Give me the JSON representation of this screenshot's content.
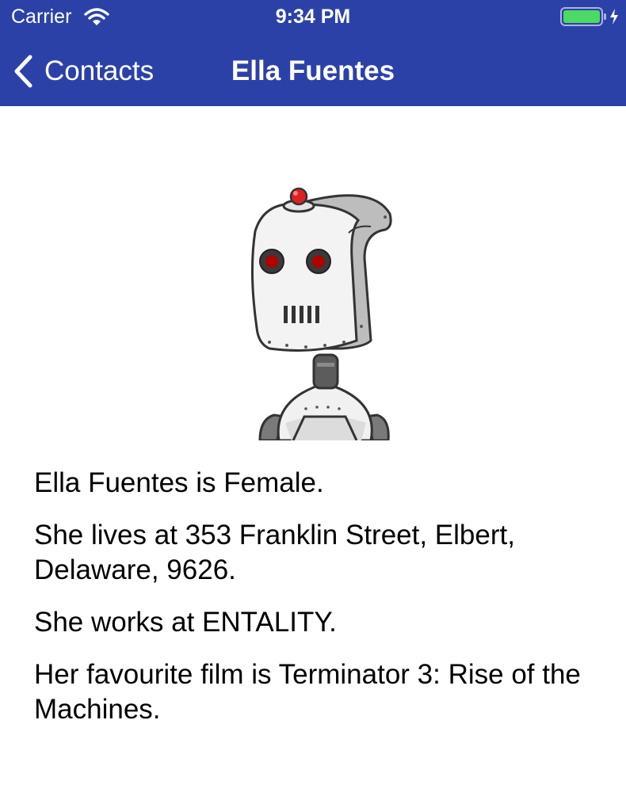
{
  "status_bar": {
    "carrier": "Carrier",
    "time": "9:34 PM"
  },
  "nav": {
    "back_label": "Contacts",
    "title": "Ella Fuentes"
  },
  "colors": {
    "nav_background": "#2c41a8",
    "battery_fill": "#4cd964"
  },
  "avatar_icon": "robot-avatar",
  "details": {
    "gender_line": "Ella Fuentes is Female.",
    "address_line": "She lives at 353 Franklin Street, Elbert, Delaware, 9626.",
    "work_line": "She works at ENTALITY.",
    "film_line": "Her favourite film is Terminator 3: Rise of the Machines."
  }
}
